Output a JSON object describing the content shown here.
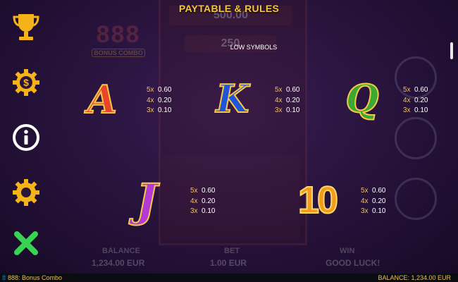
{
  "header": {
    "title": "PAYTABLE & RULES"
  },
  "section": {
    "label": "LOW SYMBOLS"
  },
  "menu": [
    {
      "name": "trophy-icon",
      "color": "#f5b31a"
    },
    {
      "name": "coin-gear-icon",
      "color": "#f5b31a"
    },
    {
      "name": "info-icon",
      "color": "#ffffff"
    },
    {
      "name": "settings-gear-icon",
      "color": "#f5b31a"
    },
    {
      "name": "close-icon",
      "color": "#39d353"
    }
  ],
  "symbols": [
    {
      "glyph": "A",
      "color": "#e8452a",
      "outline": "#f7c84a",
      "pays": [
        {
          "mult": "5x",
          "value": "0.60"
        },
        {
          "mult": "4x",
          "value": "0.20"
        },
        {
          "mult": "3x",
          "value": "0.10"
        }
      ]
    },
    {
      "glyph": "K",
      "color": "#1f56d9",
      "outline": "#f7c84a",
      "pays": [
        {
          "mult": "5x",
          "value": "0.60"
        },
        {
          "mult": "4x",
          "value": "0.20"
        },
        {
          "mult": "3x",
          "value": "0.10"
        }
      ]
    },
    {
      "glyph": "Q",
      "color": "#3aa831",
      "outline": "#f7c84a",
      "pays": [
        {
          "mult": "5x",
          "value": "0.60"
        },
        {
          "mult": "4x",
          "value": "0.20"
        },
        {
          "mult": "3x",
          "value": "0.10"
        }
      ]
    },
    {
      "glyph": "J",
      "color": "#b43ad6",
      "outline": "#f7c84a",
      "pays": [
        {
          "mult": "5x",
          "value": "0.60"
        },
        {
          "mult": "4x",
          "value": "0.20"
        },
        {
          "mult": "3x",
          "value": "0.10"
        }
      ]
    },
    {
      "glyph": "10",
      "color": "#f59a1a",
      "outline": "#f7d86a",
      "pays": [
        {
          "mult": "5x",
          "value": "0.60"
        },
        {
          "mult": "4x",
          "value": "0.20"
        },
        {
          "mult": "3x",
          "value": "0.10"
        }
      ]
    }
  ],
  "background": {
    "logo": "888",
    "logo_sub": "BONUS COMBO",
    "jackpot": "500.00",
    "jackpot2": "250",
    "balance_label": "BALANCE",
    "balance_value": "1,234.00 EUR",
    "bet_label": "BET",
    "bet_value": "1.00 EUR",
    "win_label": "WIN",
    "win_value": "GOOD LUCK!"
  },
  "footer": {
    "game_name": "888: Bonus Combo",
    "balance": "BALANCE: 1,234.00 EUR"
  }
}
